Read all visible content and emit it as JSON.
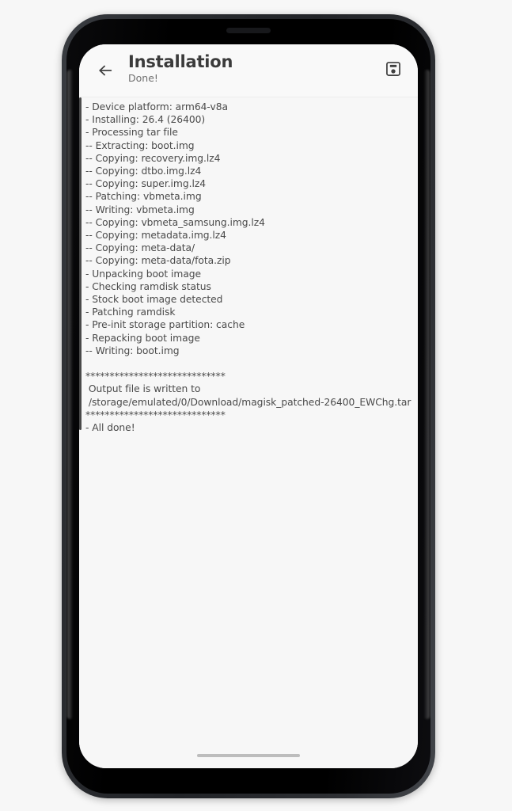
{
  "device": {
    "frame_color": "#2b2d31",
    "screen_background": "#f7f7f7",
    "earpiece_label": "earpiece-speaker"
  },
  "toolbar": {
    "back_icon": "arrow-left-icon",
    "title": "Installation",
    "subtitle": "Done!",
    "save_icon": "save-floppy-disk-icon",
    "background": "#f9f9f9",
    "title_color": "#3b3b3b",
    "subtitle_color": "#6f6f6f"
  },
  "log": {
    "text_color": "#4a4a4a",
    "scrollbar_color": "#4a4a4a",
    "lines": [
      "- Device platform: arm64-v8a",
      "- Installing: 26.4 (26400)",
      "- Processing tar file",
      "-- Extracting: boot.img",
      "-- Copying: recovery.img.lz4",
      "-- Copying: dtbo.img.lz4",
      "-- Copying: super.img.lz4",
      "-- Patching: vbmeta.img",
      "-- Writing: vbmeta.img",
      "-- Copying: vbmeta_samsung.img.lz4",
      "-- Copying: metadata.img.lz4",
      "-- Copying: meta-data/",
      "-- Copying: meta-data/fota.zip",
      "- Unpacking boot image",
      "- Checking ramdisk status",
      "- Stock boot image detected",
      "- Patching ramdisk",
      "- Pre-init storage partition: cache",
      "- Repacking boot image",
      "-- Writing: boot.img",
      "",
      "*****************************",
      " Output file is written to",
      " /storage/emulated/0/Download/magisk_patched-26400_EWChg.tar",
      "*****************************",
      "- All done!"
    ]
  },
  "navigation": {
    "gesture_bar_label": "gesture-navigation-bar",
    "gesture_bar_color": "#bdbdbd"
  }
}
